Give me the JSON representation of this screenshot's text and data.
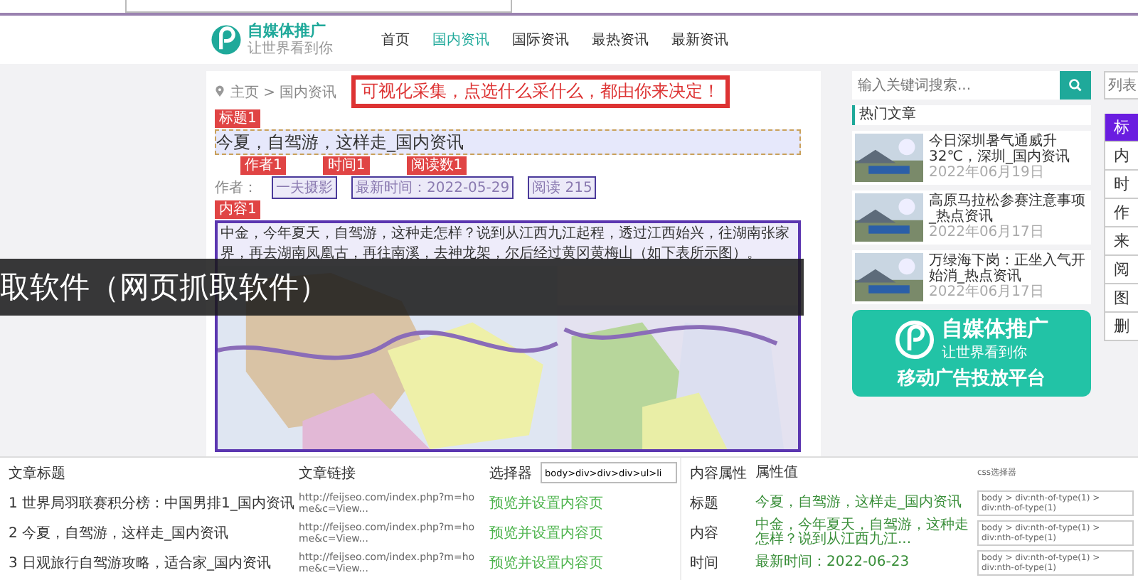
{
  "site": {
    "logo": "自媒体推广",
    "logo_tagline": "让世界看到你",
    "nav": [
      {
        "label": "首页",
        "selected": false
      },
      {
        "label": "国内资讯",
        "selected": true
      },
      {
        "label": "国际资讯",
        "selected": false
      },
      {
        "label": "最热资讯",
        "selected": false
      },
      {
        "label": "最新资讯",
        "selected": false
      }
    ]
  },
  "article": {
    "breadcrumb": "主页 > 国内资讯",
    "callout": "可视化采集，点选什么采什么，都由你来决定！",
    "title_tag": "标题1",
    "title": "今夏，自驾游，这样走_国内资讯",
    "meta_tags": [
      "作者1",
      "时间1",
      "阅读数1"
    ],
    "author_label": "作者：",
    "meta_values": [
      "一夫摄影",
      "最新时间：2022-05-29",
      "阅读 215"
    ],
    "content_tag": "内容1",
    "paragraph": "中金，今年夏天，自驾游，这种走怎样？说到从江西九江起程，透过江西始兴，往湖南张家界，再去湖南凤凰古，再往南溪，去神龙架，尔后经过黄冈黄梅山（如下表所示图）。"
  },
  "banner": {
    "text": "取软件（网页抓取软件）"
  },
  "sidebar": {
    "search_placeholder": "输入关键词搜索...",
    "hot_title": "热门文章",
    "articles": [
      {
        "title": "今日深圳暑气通威升32℃，深圳_国内资讯",
        "date": "2022年06月19日"
      },
      {
        "title": "高原马拉松参赛注意事项_热点资讯",
        "date": "2022年06月17日"
      },
      {
        "title": "万绿海下岗：正坐入气开始消_热点资讯",
        "date": "2022年06月17日"
      }
    ],
    "ad": {
      "brand": "自媒体推广",
      "tagline": "让世界看到你",
      "slogan": "移动广告投放平台"
    }
  },
  "right_panel": {
    "search_placeholder": "列表",
    "buttons": [
      {
        "label": "标",
        "selected": true
      },
      {
        "label": "内",
        "selected": false
      },
      {
        "label": "时",
        "selected": false
      },
      {
        "label": "作",
        "selected": false
      },
      {
        "label": "来",
        "selected": false
      },
      {
        "label": "阅",
        "selected": false
      },
      {
        "label": "图",
        "selected": false
      },
      {
        "label": "删",
        "selected": false
      }
    ]
  },
  "bottom": {
    "list": {
      "columns": [
        "文章标题",
        "文章链接",
        "选择器"
      ],
      "selector": "body>div>div>div>ul>li",
      "rows": [
        {
          "title": "1 世界局羽联赛积分榜：中国男排1_国内资讯",
          "url": "http://feijseo.com/index.php?m=home&c=View...",
          "action": "预览并设置内容页"
        },
        {
          "title": "2 今夏，自驾游，这样走_国内资讯",
          "url": "http://feijseo.com/index.php?m=home&c=View...",
          "action": "预览并设置内容页"
        },
        {
          "title": "3 日观旅行自驾游攻略，适合家_国内资讯",
          "url": "http://feijseo.com/index.php?m=home&c=View...",
          "action": "预览并设置内容页"
        }
      ]
    },
    "attributes": {
      "columns": [
        "内容属性",
        "属性值",
        "css选择器"
      ],
      "rows": [
        {
          "name": "标题",
          "value": "今夏，自驾游，这样走_国内资讯",
          "selector": "body > div:nth-of-type(1) > div:nth-of-type(1)"
        },
        {
          "name": "内容",
          "value": "中金，今年夏天，自驾游，这种走怎样？说到从江西九江...",
          "selector": "body > div:nth-of-type(1) > div:nth-of-type(1)"
        },
        {
          "name": "时间",
          "value": "最新时间：2022-06-23",
          "selector": "body > div:nth-of-type(1) > div:nth-of-type(1)"
        }
      ]
    }
  }
}
